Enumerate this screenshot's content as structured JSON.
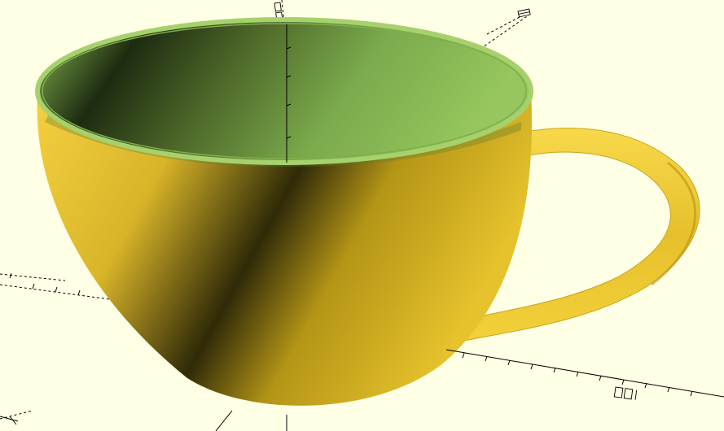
{
  "viewport": {
    "background": "#ffffe5",
    "model": "cup-with-handle",
    "colors": {
      "outer_body": "#f0cc3a",
      "handle": "#f5d63a",
      "inner_surface": "#8db85a",
      "rim": "#9cc96a",
      "axis_lines": "#000000"
    },
    "axis_scale_labels": {
      "x_axis": "001",
      "y_axis": "0",
      "z_axis": "001"
    }
  }
}
